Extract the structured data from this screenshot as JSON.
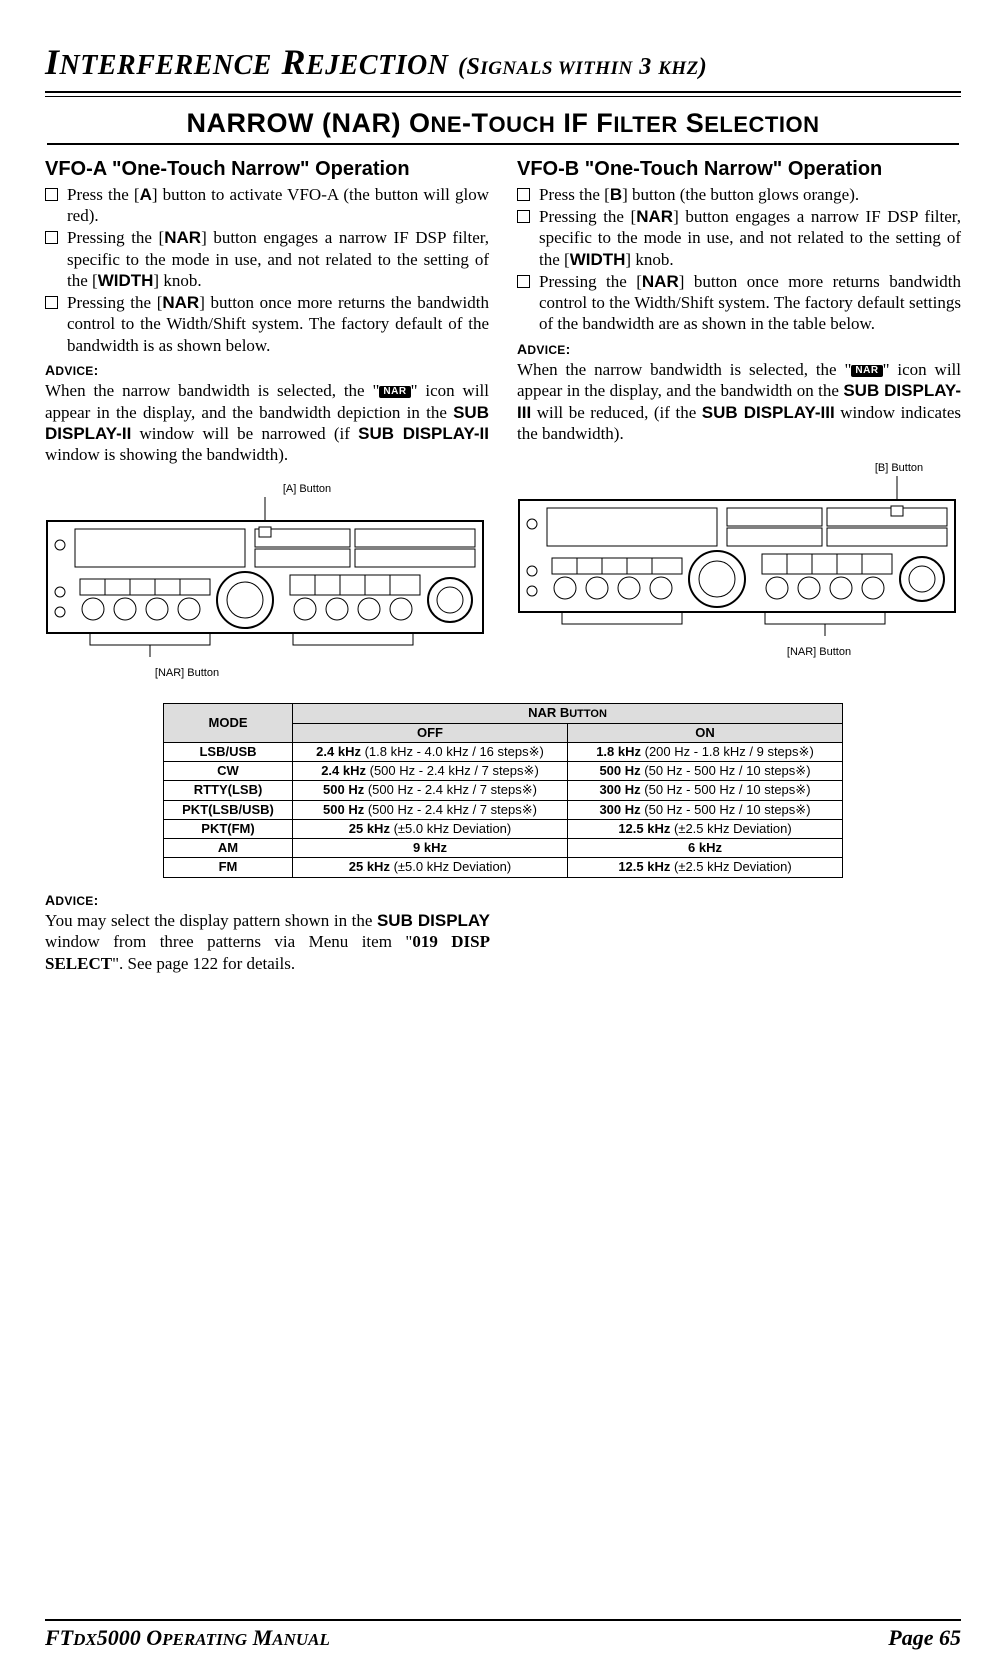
{
  "pageTitle": {
    "big1": "I",
    "rest1": "NTERFERENCE",
    "big2": "R",
    "rest2": "EJECTION",
    "sub1": "(S",
    "sub2": "IGNALS",
    "sub3": " WITHIN",
    "sub4": " 3 ",
    "sub5": "KHZ",
    "sub6": ")"
  },
  "sectionHeading": {
    "p1": "NARROW (NAR) O",
    "p2": "NE",
    "p3": "-T",
    "p4": "OUCH",
    "p5": " IF F",
    "p6": "ILTER",
    "p7": " S",
    "p8": "ELECTION"
  },
  "left": {
    "heading": "VFO-A \"One-Touch Narrow\" Operation",
    "b1a": "Press the [",
    "b1btn": "A",
    "b1b": "] button to activate VFO-A (the button will glow red).",
    "b2a": "Pressing the [",
    "b2btn": "NAR",
    "b2b": "] button engages a narrow IF DSP filter, specific to the mode in use, and not related to the setting of the [",
    "b2btn2": "WIDTH",
    "b2c": "] knob.",
    "b3a": "Pressing the [",
    "b3btn": "NAR",
    "b3b": "] button once more returns the bandwidth control to the Width/Shift system. The factory default of the bandwidth is as shown below.",
    "adviceLabelA": "A",
    "adviceLabelB": "DVICE",
    "adviceLabelC": ":",
    "adv1a": "When the narrow bandwidth is selected, the \"",
    "adv1nar": "NAR",
    "adv1b": "\" icon will appear in the display, and the bandwidth depiction in the ",
    "adv1disp": "SUB DISPLAY-II",
    "adv1c": " window will be narrowed (if ",
    "adv1disp2": "SUB DISPLAY-II",
    "adv1d": " window is showing the bandwidth).",
    "diagA": "[A] Button",
    "diagNAR": "[NAR] Button"
  },
  "right": {
    "heading": "VFO-B \"One-Touch Narrow\" Operation",
    "b1a": "Press the [",
    "b1btn": "B",
    "b1b": "] button (the button glows orange).",
    "b2a": "Pressing the [",
    "b2btn": "NAR",
    "b2b": "] button engages a narrow IF DSP filter, specific to the mode in use, and not related to the setting of the [",
    "b2btn2": "WIDTH",
    "b2c": "] knob.",
    "b3a": "Pressing the [",
    "b3btn": "NAR",
    "b3b": "] button once more returns bandwidth control to the Width/Shift system. The factory default settings of the bandwidth are as shown in the table below.",
    "adviceLabelA": "A",
    "adviceLabelB": "DVICE",
    "adviceLabelC": ":",
    "adv1a": "When the narrow bandwidth is selected, the \"",
    "adv1nar": "NAR",
    "adv1b": "\" icon will appear in the display, and the bandwidth on the ",
    "adv1disp": "SUB DISPLAY-III",
    "adv1c": " will be reduced, (if the ",
    "adv1disp2": "SUB DISPLAY-III",
    "adv1d": " window indicates the bandwidth).",
    "diagB": "[B] Button",
    "diagNAR": "[NAR] Button"
  },
  "table": {
    "modeHdr": "MODE",
    "narHdrA": "NAR B",
    "narHdrB": "UTTON",
    "offHdr": "OFF",
    "onHdr": "ON",
    "rows": [
      {
        "mode": "LSB/USB",
        "off_b": "2.4 kHz ",
        "off_n": "(1.8 kHz - 4.0 kHz / 16 steps",
        "on_b": "1.8 kHz ",
        "on_n": "(200 Hz - 1.8 kHz / 9 steps"
      },
      {
        "mode": "CW",
        "off_b": "2.4 kHz ",
        "off_n": "(500 Hz - 2.4 kHz / 7 steps",
        "on_b": "500 Hz ",
        "on_n": "(50 Hz - 500 Hz / 10 steps"
      },
      {
        "mode": "RTTY(LSB)",
        "off_b": "500 Hz ",
        "off_n": "(500 Hz - 2.4 kHz / 7 steps",
        "on_b": "300 Hz ",
        "on_n": "(50 Hz - 500 Hz / 10 steps"
      },
      {
        "mode": "PKT(LSB/USB)",
        "off_b": "500 Hz ",
        "off_n": "(500 Hz - 2.4 kHz / 7 steps",
        "on_b": "300 Hz ",
        "on_n": "(50 Hz - 500 Hz / 10 steps"
      },
      {
        "mode": "PKT(FM)",
        "off_b": "25 kHz ",
        "off_n": "(±5.0 kHz Deviation)",
        "on_b": "12.5 kHz ",
        "on_n": "(±2.5 kHz Deviation)",
        "nostar": true
      },
      {
        "mode": "AM",
        "off_b": "9 kHz",
        "off_n": "",
        "on_b": "6 kHz",
        "on_n": "",
        "nostar": true
      },
      {
        "mode": "FM",
        "off_b": "25 kHz ",
        "off_n": "(±5.0 kHz Deviation)",
        "on_b": "12.5 kHz ",
        "on_n": "(±2.5 kHz Deviation)",
        "nostar": true
      }
    ],
    "star": "※"
  },
  "afterTable": {
    "adviceLabelA": "A",
    "adviceLabelB": "DVICE",
    "adviceLabelC": ":",
    "t1": "You may select the display pattern shown in the ",
    "t2": "SUB DISPLAY",
    "t3": " window from three patterns via Menu item \"",
    "t4": "019 DISP SELECT",
    "t5": "\". See page 122 for details."
  },
  "footer": {
    "leftA": "FT",
    "leftB": "DX",
    "leftC": "5000 O",
    "leftD": "PERATING",
    "leftE": " M",
    "leftF": "ANUAL",
    "right": "Page 65"
  }
}
